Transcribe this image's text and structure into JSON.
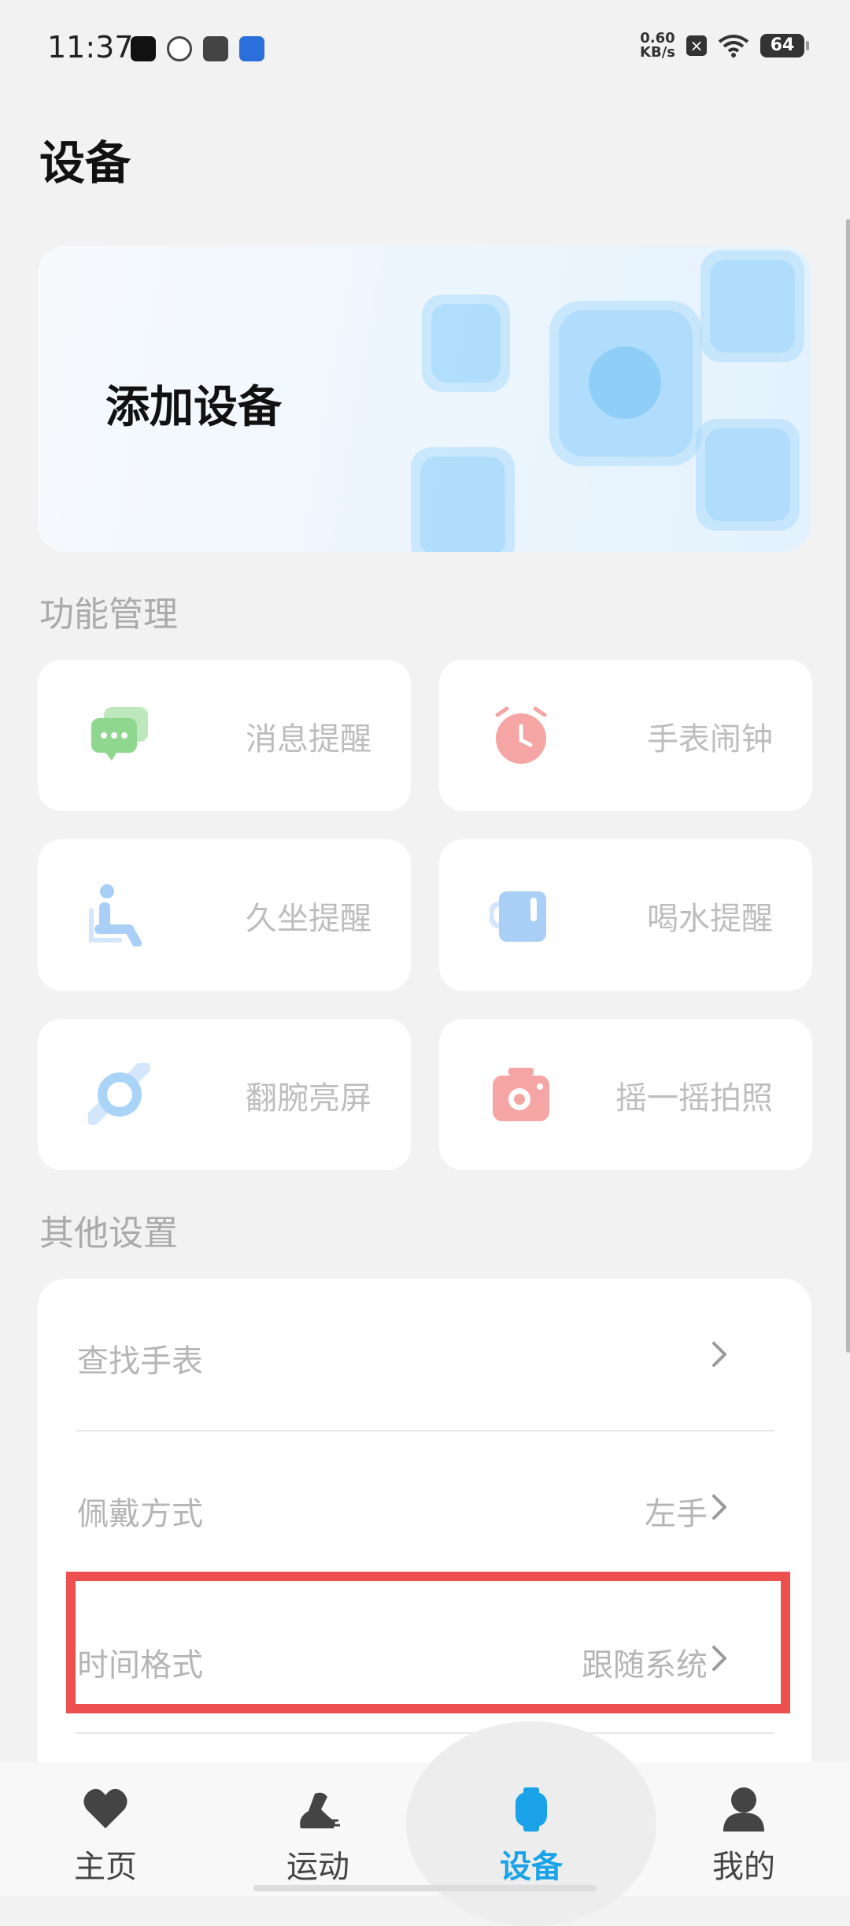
{
  "status_bar": {
    "time": "11:37",
    "speed_value": "0.60",
    "speed_unit": "KB/s",
    "battery": "64"
  },
  "page": {
    "title": "设备"
  },
  "add_device": {
    "label": "添加设备"
  },
  "features": {
    "section_title": "功能管理",
    "items": [
      {
        "label": "消息提醒",
        "icon": "message-bubble-icon",
        "color": "#8fd68e"
      },
      {
        "label": "手表闹钟",
        "icon": "alarm-clock-icon",
        "color": "#f6a5a5"
      },
      {
        "label": "久坐提醒",
        "icon": "sedentary-person-icon",
        "color": "#a9cff7"
      },
      {
        "label": "喝水提醒",
        "icon": "water-cup-icon",
        "color": "#a9cff7"
      },
      {
        "label": "翻腕亮屏",
        "icon": "wrist-ring-icon",
        "color": "#a9d3f7"
      },
      {
        "label": "摇一摇拍照",
        "icon": "camera-icon",
        "color": "#f6a5a5"
      }
    ]
  },
  "other_settings": {
    "section_title": "其他设置",
    "rows": [
      {
        "label": "查找手表",
        "value": ""
      },
      {
        "label": "佩戴方式",
        "value": "左手"
      },
      {
        "label": "时间格式",
        "value": "跟随系统"
      }
    ]
  },
  "bottom_nav": {
    "items": [
      {
        "label": "主页",
        "icon": "heart-icon"
      },
      {
        "label": "运动",
        "icon": "running-shoe-icon"
      },
      {
        "label": "设备",
        "icon": "watch-icon",
        "active": true
      },
      {
        "label": "我的",
        "icon": "person-icon"
      }
    ],
    "active_color": "#1aa3e8"
  }
}
